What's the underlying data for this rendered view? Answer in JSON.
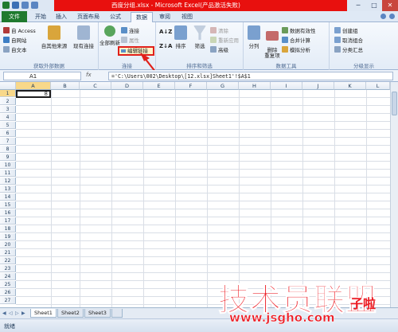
{
  "window": {
    "title": "西度分组.xlsx - Microsoft Excel(产品激活失败)",
    "controls": [
      "─",
      "□",
      "✕"
    ]
  },
  "tabs": {
    "file": "文件",
    "items": [
      "开始",
      "插入",
      "页面布局",
      "公式",
      "数据",
      "审阅",
      "视图"
    ],
    "active": "数据"
  },
  "ribbon": {
    "external": {
      "label": "获取外部数据",
      "from_access": "自 Access",
      "from_web": "自网站",
      "from_text": "自文本",
      "from_other": "自其他来源",
      "existing": "现有连接"
    },
    "connections": {
      "label": "连接",
      "refresh_all": "全部刷新",
      "connections": "连接",
      "properties": "属性",
      "edit_links": "编辑链接"
    },
    "sort_filter": {
      "label": "排序和筛选",
      "sort": "排序",
      "filter": "筛选",
      "clear": "清除",
      "reapply": "重新应用",
      "advanced": "高级"
    },
    "data_tools": {
      "label": "数据工具",
      "split": "分列",
      "remove_dup": "删除\n重复项",
      "validation": "数据有效性",
      "consolidate": "合并计算",
      "whatif": "模拟分析"
    },
    "outline": {
      "label": "分级显示",
      "group": "创建组",
      "ungroup": "取消组合",
      "subtotal": "分类汇总"
    }
  },
  "formula_bar": {
    "name_box": "A1",
    "fx": "fx",
    "formula": "='C:\\Users\\002\\Desktop\\[12.xlsx]Sheet1'!$A$1"
  },
  "grid": {
    "columns": [
      "A",
      "B",
      "C",
      "D",
      "E",
      "F",
      "G",
      "H",
      "I",
      "J",
      "K",
      "L"
    ],
    "rows": [
      "1",
      "2",
      "3",
      "4",
      "5",
      "6",
      "7",
      "8",
      "9",
      "10",
      "11",
      "12",
      "13",
      "14",
      "15",
      "16",
      "17",
      "18",
      "19",
      "20",
      "21",
      "22",
      "23",
      "24",
      "25",
      "26",
      "27"
    ],
    "a1_value": "8"
  },
  "sheets": {
    "items": [
      "Sheet1",
      "Sheet2",
      "Sheet3"
    ],
    "active": "Sheet1"
  },
  "status": {
    "text": "就绪"
  },
  "watermark": {
    "brand": "技术员联盟",
    "suffix": "子啦",
    "url": "www.jsgho.com"
  },
  "colors": {
    "title_red": "#e8100e",
    "file_tab": "#1f7a2f",
    "highlight_red": "#e0201a",
    "watermark_red": "#ec1c24"
  }
}
